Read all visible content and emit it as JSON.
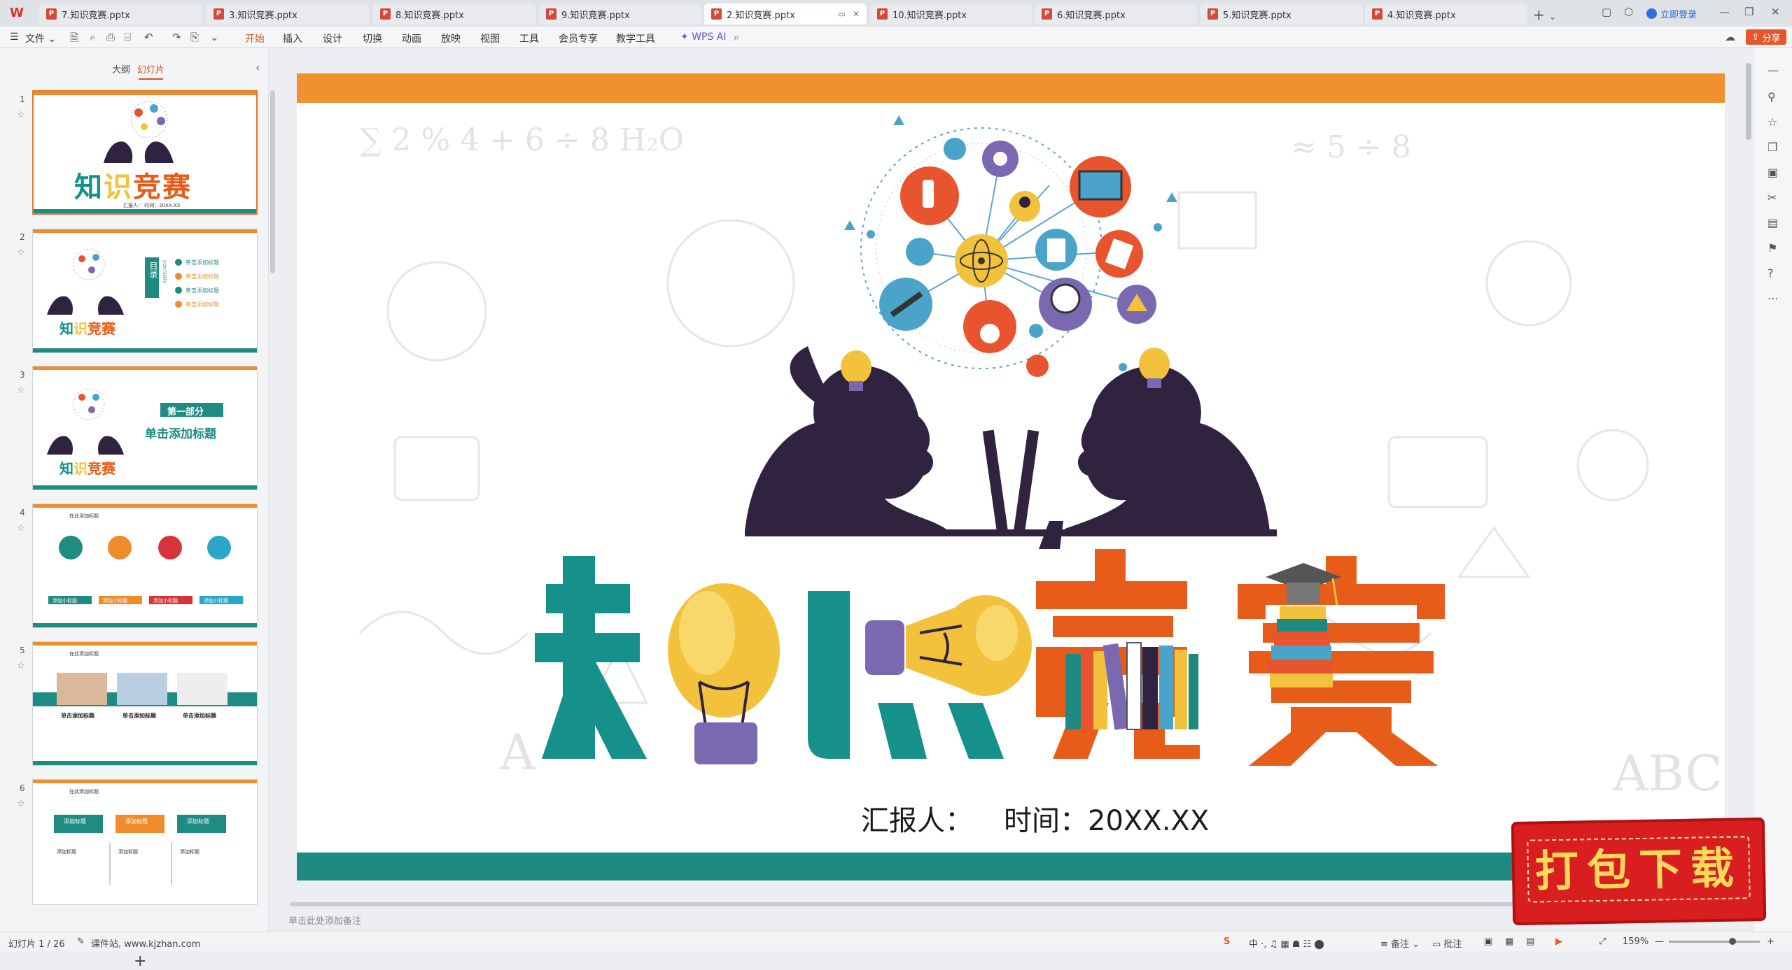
{
  "tabs": [
    {
      "label": "7.知识竞赛.pptx",
      "active": false
    },
    {
      "label": "3.知识竞赛.pptx",
      "active": false
    },
    {
      "label": "8.知识竞赛.pptx",
      "active": false
    },
    {
      "label": "9.知识竞赛.pptx",
      "active": false
    },
    {
      "label": "2.知识竞赛.pptx",
      "active": true
    },
    {
      "label": "10.知识竞赛.pptx",
      "active": false
    },
    {
      "label": "6.知识竞赛.pptx",
      "active": false
    },
    {
      "label": "5.知识竞赛.pptx",
      "active": false
    },
    {
      "label": "4.知识竞赛.pptx",
      "active": false
    }
  ],
  "login_label": "立即登录",
  "menu": {
    "file": "文件",
    "items": [
      "开始",
      "插入",
      "设计",
      "切换",
      "动画",
      "放映",
      "视图",
      "工具",
      "会员专享",
      "教学工具"
    ],
    "active": "开始",
    "wps_ai": "WPS AI",
    "share": "分享"
  },
  "left_panel": {
    "tab_outline": "大纲",
    "tab_slides": "幻灯片",
    "slides": [
      {
        "num": "1"
      },
      {
        "num": "2",
        "toc": "目录",
        "toc_en": "CONTENTS",
        "items": [
          "单击添加标题",
          "单击添加标题",
          "单击添加标题",
          "单击添加标题"
        ]
      },
      {
        "num": "3",
        "part": "第一部分",
        "heading": "单击添加标题"
      },
      {
        "num": "4",
        "header": "在此添加标题",
        "buttons": [
          "添加小标题",
          "添加小标题",
          "添加小标题",
          "添加小标题"
        ]
      },
      {
        "num": "5",
        "header": "在此添加标题",
        "cols": [
          "单击添加标题",
          "单击添加标题",
          "单击添加标题"
        ]
      },
      {
        "num": "6",
        "header": "在此添加标题",
        "cols": [
          "添加标题",
          "添加标题",
          "添加标题"
        ],
        "sub": "添加标题"
      }
    ],
    "add_slide": "+"
  },
  "slide": {
    "title": "知识竞赛",
    "reporter": "汇报人：",
    "time": "时间：20XX.XX",
    "thumb_reporter": "汇报人：    时间：20XX.XX"
  },
  "notes_placeholder": "单击此处添加备注",
  "status": {
    "slide_counter": "幻灯片 1 / 26",
    "theme": "课件站, www.kjzhan.com",
    "notes": "备注",
    "comments": "批注",
    "zoom": "159%"
  },
  "badge": {
    "text": "打包下载"
  },
  "colors": {
    "accent": "#d6531e",
    "teal": "#1e8a7f",
    "orange": "#f0902e",
    "title_orange": "#e85c1a",
    "title_teal": "#16908a",
    "purple": "#7a68b0",
    "bulb_yellow": "#f2c23c"
  }
}
